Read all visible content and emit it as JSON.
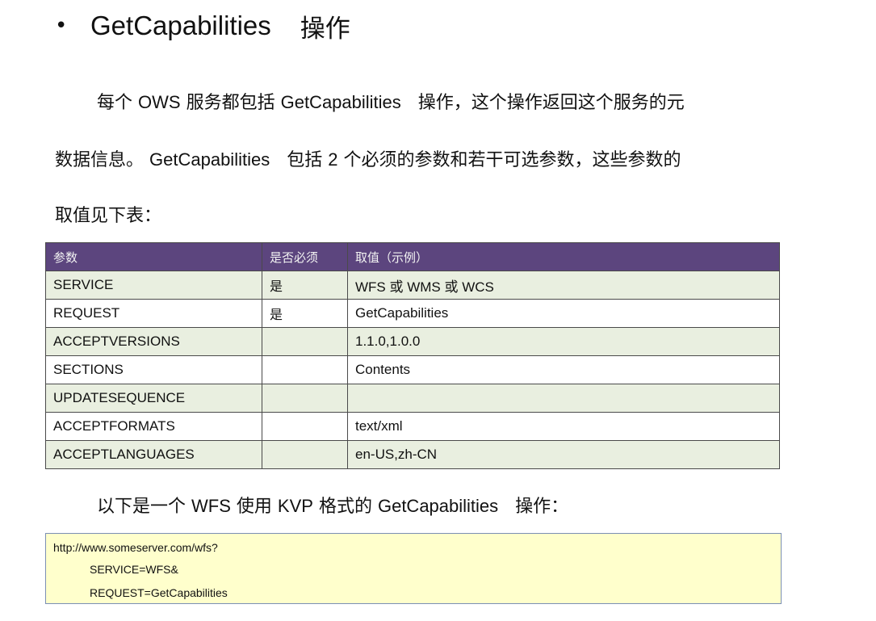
{
  "heading": {
    "bullet": "•",
    "title_en": "GetCapabilities",
    "title_cn": "操作"
  },
  "intro": {
    "line1_a": "每个",
    "line1_b": "OWS",
    "line1_c": "服务都包括",
    "line1_d": "GetCapabilities",
    "line1_e": "操作，这个操作返回这个服务的元",
    "line2_a": "数据信息。",
    "line2_b": "GetCapabilities",
    "line2_c": "包括",
    "line2_d": "2",
    "line2_e": "个必须的参数和若干可选参数，这些参数的",
    "line3": "取值见下表："
  },
  "table": {
    "headers": [
      "参数",
      "是否必须",
      "取值（示例）"
    ],
    "rows": [
      {
        "param": "SERVICE",
        "required": "是",
        "value": "WFS 或 WMS 或 WCS"
      },
      {
        "param": "REQUEST",
        "required": "是",
        "value": "GetCapabilities"
      },
      {
        "param": "ACCEPTVERSIONS",
        "required": "",
        "value": "1.1.0,1.0.0"
      },
      {
        "param": "SECTIONS",
        "required": "",
        "value": "Contents"
      },
      {
        "param": "UPDATESEQUENCE",
        "required": "",
        "value": ""
      },
      {
        "param": "ACCEPTFORMATS",
        "required": "",
        "value": "text/xml"
      },
      {
        "param": "ACCEPTLANGUAGES",
        "required": "",
        "value": "en-US,zh-CN"
      }
    ]
  },
  "example": {
    "intro_a": "以下是一个",
    "intro_b": "WFS",
    "intro_c": "使用",
    "intro_d": "KVP",
    "intro_e": "格式的",
    "intro_f": "GetCapabilities",
    "intro_g": "操作：",
    "code_lines": [
      "http://www.someserver.com/wfs?",
      "SERVICE=WFS&",
      "REQUEST=GetCapabilities"
    ]
  },
  "colors": {
    "table_header_bg": "#5c457e",
    "table_row_alt_bg": "#e9efe0",
    "code_box_bg": "#ffffcc",
    "code_box_border": "#7b8fb4"
  }
}
